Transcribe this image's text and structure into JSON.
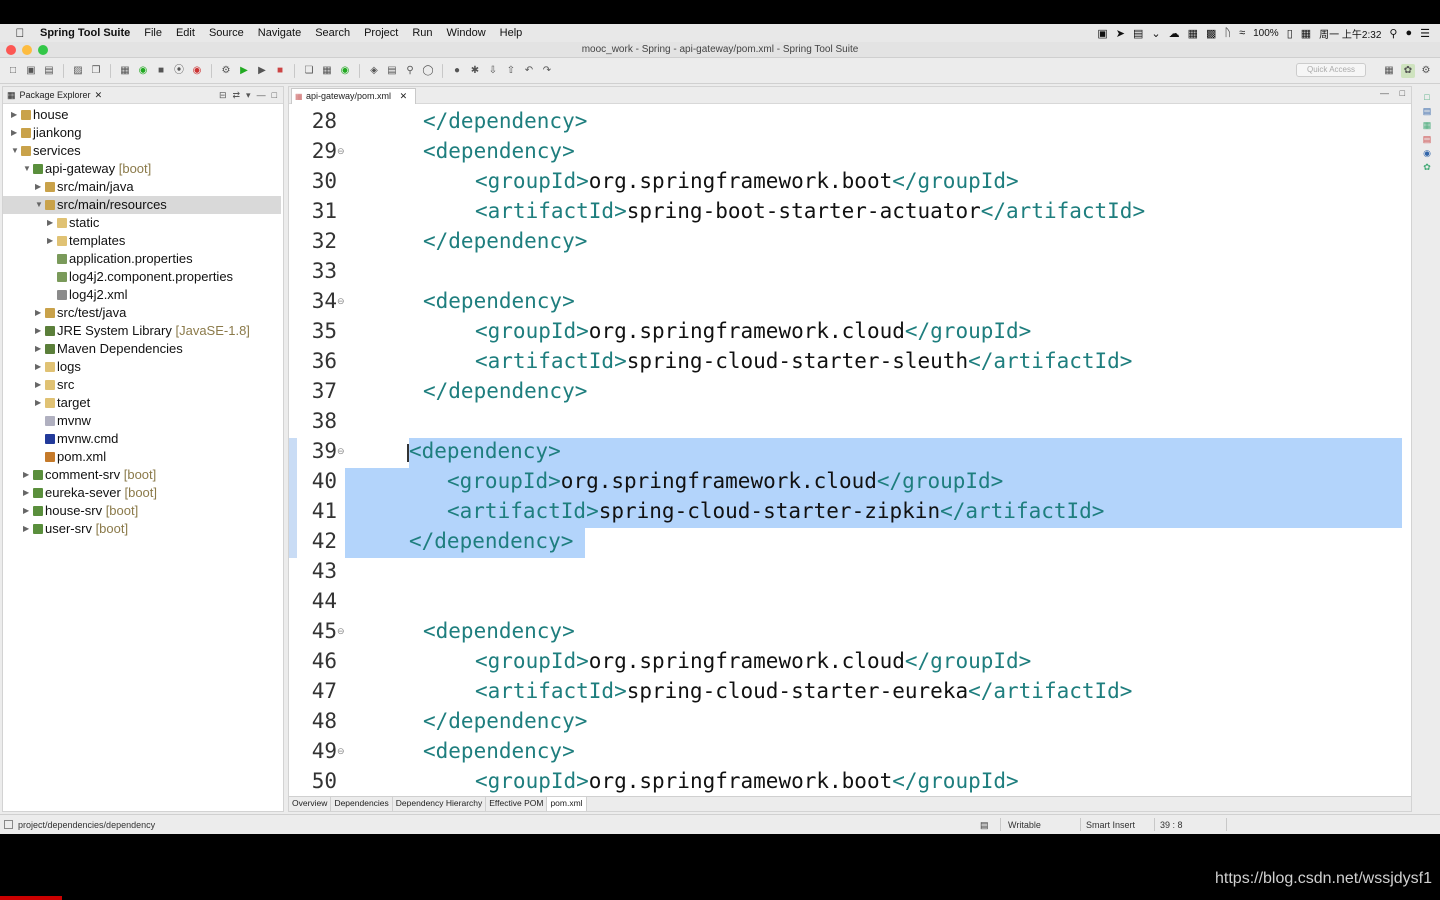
{
  "menubar": {
    "app_name": "Spring Tool Suite",
    "items": [
      "File",
      "Edit",
      "Source",
      "Navigate",
      "Search",
      "Project",
      "Run",
      "Window",
      "Help"
    ],
    "battery": "100%",
    "clock": "周一 上午2:32"
  },
  "window": {
    "title": "mooc_work - Spring - api-gateway/pom.xml - Spring Tool Suite"
  },
  "toolbar": {
    "quick_access_placeholder": "Quick Access"
  },
  "explorer": {
    "title": "Package Explorer",
    "nodes": [
      {
        "label": "house",
        "deco": "",
        "icon": "project-folder-icon",
        "depth": 0,
        "expanded": false,
        "selected": false
      },
      {
        "label": "jiankong",
        "deco": "",
        "icon": "project-folder-icon",
        "depth": 0,
        "expanded": false,
        "selected": false
      },
      {
        "label": "services",
        "deco": "",
        "icon": "project-folder-icon",
        "depth": 0,
        "expanded": true,
        "selected": false
      },
      {
        "label": "api-gateway",
        "deco": "[boot]",
        "icon": "boot-project-icon",
        "depth": 1,
        "expanded": true,
        "selected": false
      },
      {
        "label": "src/main/java",
        "deco": "",
        "icon": "source-folder-icon",
        "depth": 2,
        "expanded": false,
        "selected": false
      },
      {
        "label": "src/main/resources",
        "deco": "",
        "icon": "source-folder-icon",
        "depth": 2,
        "expanded": true,
        "selected": true
      },
      {
        "label": "static",
        "deco": "",
        "icon": "folder-icon",
        "depth": 3,
        "expanded": false,
        "selected": false
      },
      {
        "label": "templates",
        "deco": "",
        "icon": "folder-icon",
        "depth": 3,
        "expanded": false,
        "selected": false
      },
      {
        "label": "application.properties",
        "deco": "",
        "icon": "properties-file-icon",
        "depth": 3,
        "expanded": null,
        "selected": false
      },
      {
        "label": "log4j2.component.properties",
        "deco": "",
        "icon": "properties-file-icon",
        "depth": 3,
        "expanded": null,
        "selected": false
      },
      {
        "label": "log4j2.xml",
        "deco": "",
        "icon": "xml-file-icon",
        "depth": 3,
        "expanded": null,
        "selected": false
      },
      {
        "label": "src/test/java",
        "deco": "",
        "icon": "source-folder-icon",
        "depth": 2,
        "expanded": false,
        "selected": false
      },
      {
        "label": "JRE System Library",
        "deco": "[JavaSE-1.8]",
        "icon": "library-icon",
        "depth": 2,
        "expanded": false,
        "selected": false
      },
      {
        "label": "Maven Dependencies",
        "deco": "",
        "icon": "library-icon",
        "depth": 2,
        "expanded": false,
        "selected": false
      },
      {
        "label": "logs",
        "deco": "",
        "icon": "folder-icon",
        "depth": 2,
        "expanded": false,
        "selected": false
      },
      {
        "label": "src",
        "deco": "",
        "icon": "folder-icon",
        "depth": 2,
        "expanded": false,
        "selected": false
      },
      {
        "label": "target",
        "deco": "",
        "icon": "folder-icon",
        "depth": 2,
        "expanded": false,
        "selected": false
      },
      {
        "label": "mvnw",
        "deco": "",
        "icon": "file-icon",
        "depth": 2,
        "expanded": null,
        "selected": false
      },
      {
        "label": "mvnw.cmd",
        "deco": "",
        "icon": "cmd-file-icon",
        "depth": 2,
        "expanded": null,
        "selected": false
      },
      {
        "label": "pom.xml",
        "deco": "",
        "icon": "pom-file-icon",
        "depth": 2,
        "expanded": null,
        "selected": false
      },
      {
        "label": "comment-srv",
        "deco": "[boot]",
        "icon": "boot-project-icon",
        "depth": 1,
        "expanded": false,
        "selected": false
      },
      {
        "label": "eureka-sever",
        "deco": "[boot]",
        "icon": "boot-project-icon",
        "depth": 1,
        "expanded": false,
        "selected": false
      },
      {
        "label": "house-srv",
        "deco": "[boot]",
        "icon": "boot-project-icon",
        "depth": 1,
        "expanded": false,
        "selected": false
      },
      {
        "label": "user-srv",
        "deco": "[boot]",
        "icon": "boot-project-icon",
        "depth": 1,
        "expanded": false,
        "selected": false
      }
    ]
  },
  "editor": {
    "tab_label": "api-gateway/pom.xml",
    "lines": [
      {
        "n": "28",
        "fold": false,
        "indent": 1,
        "parts": [
          {
            "t": "</dependency>",
            "k": "tag"
          }
        ]
      },
      {
        "n": "29",
        "fold": true,
        "indent": 1,
        "parts": [
          {
            "t": "<dependency>",
            "k": "tag"
          }
        ]
      },
      {
        "n": "30",
        "fold": false,
        "indent": 2,
        "parts": [
          {
            "t": "<groupId>",
            "k": "tag"
          },
          {
            "t": "org.springframework.boot",
            "k": "text"
          },
          {
            "t": "</groupId>",
            "k": "tag"
          }
        ]
      },
      {
        "n": "31",
        "fold": false,
        "indent": 2,
        "parts": [
          {
            "t": "<artifactId>",
            "k": "tag"
          },
          {
            "t": "spring-boot-starter-actuator",
            "k": "text"
          },
          {
            "t": "</artifactId>",
            "k": "tag"
          }
        ]
      },
      {
        "n": "32",
        "fold": false,
        "indent": 1,
        "parts": [
          {
            "t": "</dependency>",
            "k": "tag"
          }
        ]
      },
      {
        "n": "33",
        "fold": false,
        "indent": 0,
        "parts": []
      },
      {
        "n": "34",
        "fold": true,
        "indent": 1,
        "parts": [
          {
            "t": "<dependency>",
            "k": "tag"
          }
        ]
      },
      {
        "n": "35",
        "fold": false,
        "indent": 2,
        "parts": [
          {
            "t": "<groupId>",
            "k": "tag"
          },
          {
            "t": "org.springframework.cloud",
            "k": "text"
          },
          {
            "t": "</groupId>",
            "k": "tag"
          }
        ]
      },
      {
        "n": "36",
        "fold": false,
        "indent": 2,
        "parts": [
          {
            "t": "<artifactId>",
            "k": "tag"
          },
          {
            "t": "spring-cloud-starter-sleuth",
            "k": "text"
          },
          {
            "t": "</artifactId>",
            "k": "tag"
          }
        ]
      },
      {
        "n": "37",
        "fold": false,
        "indent": 1,
        "parts": [
          {
            "t": "</dependency>",
            "k": "tag"
          }
        ]
      },
      {
        "n": "38",
        "fold": false,
        "indent": 0,
        "parts": []
      },
      {
        "n": "39",
        "fold": true,
        "indent": 3,
        "parts": [
          {
            "t": "<dependency>",
            "k": "tag"
          }
        ]
      },
      {
        "n": "40",
        "fold": false,
        "indent": 4,
        "parts": [
          {
            "t": "<groupId>",
            "k": "tag"
          },
          {
            "t": "org.springframework.cloud",
            "k": "text"
          },
          {
            "t": "</groupId>",
            "k": "tag"
          }
        ]
      },
      {
        "n": "41",
        "fold": false,
        "indent": 4,
        "parts": [
          {
            "t": "<artifactId>",
            "k": "tag"
          },
          {
            "t": "spring-cloud-starter-zipkin",
            "k": "text"
          },
          {
            "t": "</artifactId>",
            "k": "tag"
          }
        ]
      },
      {
        "n": "42",
        "fold": false,
        "indent": 3,
        "parts": [
          {
            "t": "</dependency>",
            "k": "tag"
          }
        ]
      },
      {
        "n": "43",
        "fold": false,
        "indent": 0,
        "parts": []
      },
      {
        "n": "44",
        "fold": false,
        "indent": 0,
        "parts": []
      },
      {
        "n": "45",
        "fold": true,
        "indent": 1,
        "parts": [
          {
            "t": "<dependency>",
            "k": "tag"
          }
        ]
      },
      {
        "n": "46",
        "fold": false,
        "indent": 2,
        "parts": [
          {
            "t": "<groupId>",
            "k": "tag"
          },
          {
            "t": "org.springframework.cloud",
            "k": "text"
          },
          {
            "t": "</groupId>",
            "k": "tag"
          }
        ]
      },
      {
        "n": "47",
        "fold": false,
        "indent": 2,
        "parts": [
          {
            "t": "<artifactId>",
            "k": "tag"
          },
          {
            "t": "spring-cloud-starter-eureka",
            "k": "text"
          },
          {
            "t": "</artifactId>",
            "k": "tag"
          }
        ]
      },
      {
        "n": "48",
        "fold": false,
        "indent": 1,
        "parts": [
          {
            "t": "</dependency>",
            "k": "tag"
          }
        ]
      },
      {
        "n": "49",
        "fold": true,
        "indent": 1,
        "parts": [
          {
            "t": "<dependency>",
            "k": "tag"
          }
        ]
      },
      {
        "n": "50",
        "fold": false,
        "indent": 2,
        "parts": [
          {
            "t": "<groupId>",
            "k": "tag"
          },
          {
            "t": "org.springframework.boot",
            "k": "text"
          },
          {
            "t": "</groupId>",
            "k": "tag"
          }
        ]
      }
    ],
    "selected_lines": [
      "39",
      "40",
      "41",
      "42"
    ],
    "bottom_tabs": [
      "Overview",
      "Dependencies",
      "Dependency Hierarchy",
      "Effective POM",
      "pom.xml"
    ],
    "active_bottom_tab": "pom.xml"
  },
  "statusbar": {
    "path": "project/dependencies/dependency",
    "mode": "Writable",
    "insert": "Smart Insert",
    "position": "39 : 8"
  },
  "watermark": "https://blog.csdn.net/wssjdysf1",
  "colors": {
    "xml_tag": "#1e7e7e",
    "selection": "#b3d4fb",
    "tree_selection": "#d9d9d9",
    "decoration": "#8b7a4a"
  }
}
